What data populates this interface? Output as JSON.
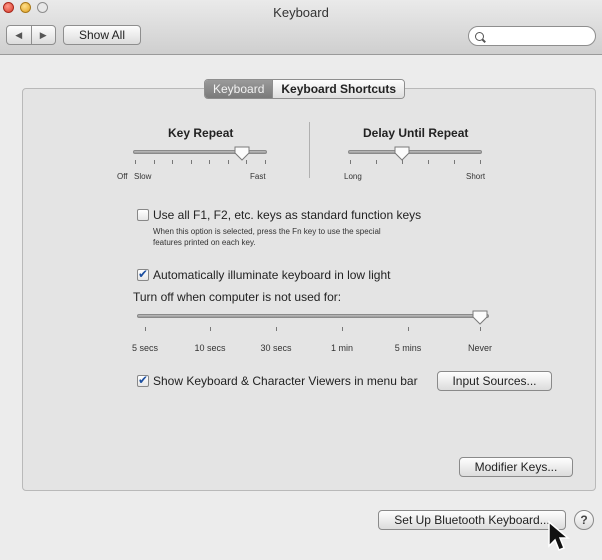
{
  "window": {
    "title": "Keyboard"
  },
  "toolbar": {
    "back": "◀",
    "forward": "▶",
    "show_all": "Show All",
    "search_placeholder": ""
  },
  "tabs": {
    "active": "Keyboard",
    "inactive": "Keyboard Shortcuts"
  },
  "key_repeat": {
    "label": "Key Repeat",
    "left_off": "Off",
    "left_slow": "Slow",
    "right": "Fast",
    "value_fraction": 0.82
  },
  "delay_until_repeat": {
    "label": "Delay Until Repeat",
    "left": "Long",
    "right": "Short",
    "value_fraction": 0.4
  },
  "function_keys": {
    "checked": false,
    "label": "Use all F1, F2, etc. keys as standard function keys",
    "help_line1": "When this option is selected, press the Fn key to use the special",
    "help_line2": "features printed on each key."
  },
  "illuminate": {
    "checked": true,
    "label": "Automatically illuminate keyboard in low light"
  },
  "turn_off": {
    "label": "Turn off when computer is not used for:",
    "ticks": [
      "5 secs",
      "10 secs",
      "30 secs",
      "1 min",
      "5 mins",
      "Never"
    ],
    "selected": "Never"
  },
  "viewers": {
    "checked": true,
    "label": "Show Keyboard & Character Viewers in menu bar"
  },
  "buttons": {
    "input_sources": "Input Sources...",
    "modifier_keys": "Modifier Keys...",
    "bluetooth": "Set Up Bluetooth Keyboard...",
    "help": "?"
  }
}
